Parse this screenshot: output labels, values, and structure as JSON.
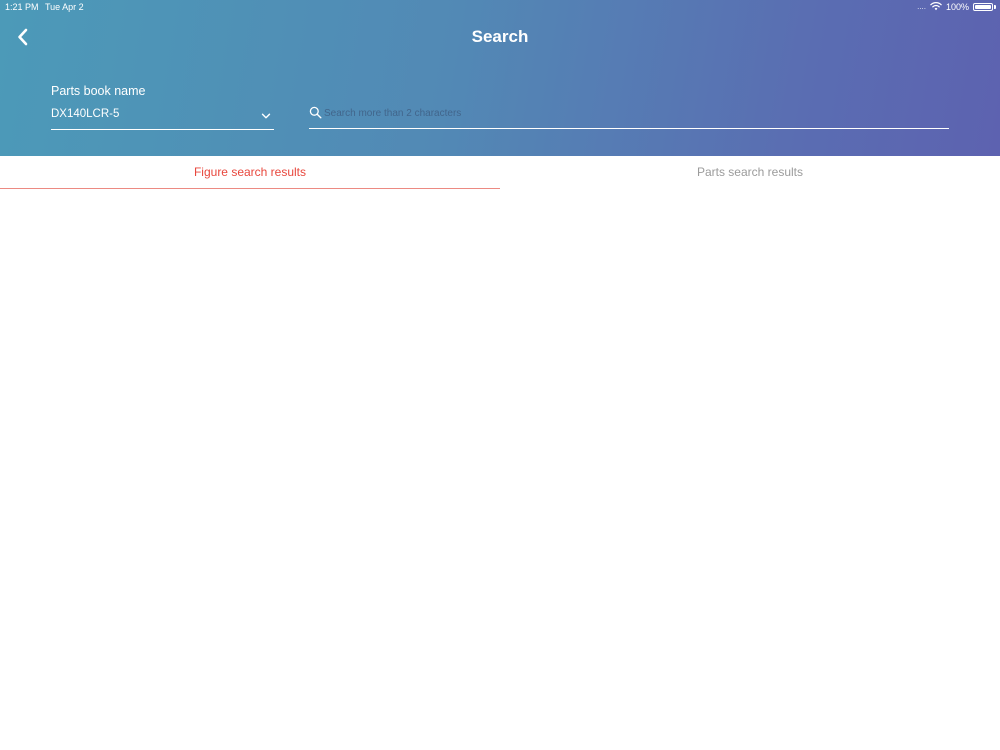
{
  "status_bar": {
    "time": "1:21 PM",
    "date": "Tue Apr 2",
    "signal": "....",
    "battery": "100%",
    "battery_level": 1.0
  },
  "header": {
    "title": "Search",
    "back_icon": "chevron-left-icon"
  },
  "parts_book": {
    "label": "Parts book name",
    "selected": "DX140LCR-5",
    "chevron_icon": "chevron-down-icon"
  },
  "search": {
    "placeholder": "Search more than 2 characters",
    "value": "",
    "icon": "search-icon"
  },
  "tabs": [
    {
      "label": "Figure search results",
      "active": true
    },
    {
      "label": "Parts search results",
      "active": false
    }
  ],
  "colors": {
    "header_gradient_start": "#4c9ab8",
    "header_gradient_end": "#5d62b0",
    "active_tab": "#e8473d",
    "inactive_tab": "#9b9b9b"
  }
}
